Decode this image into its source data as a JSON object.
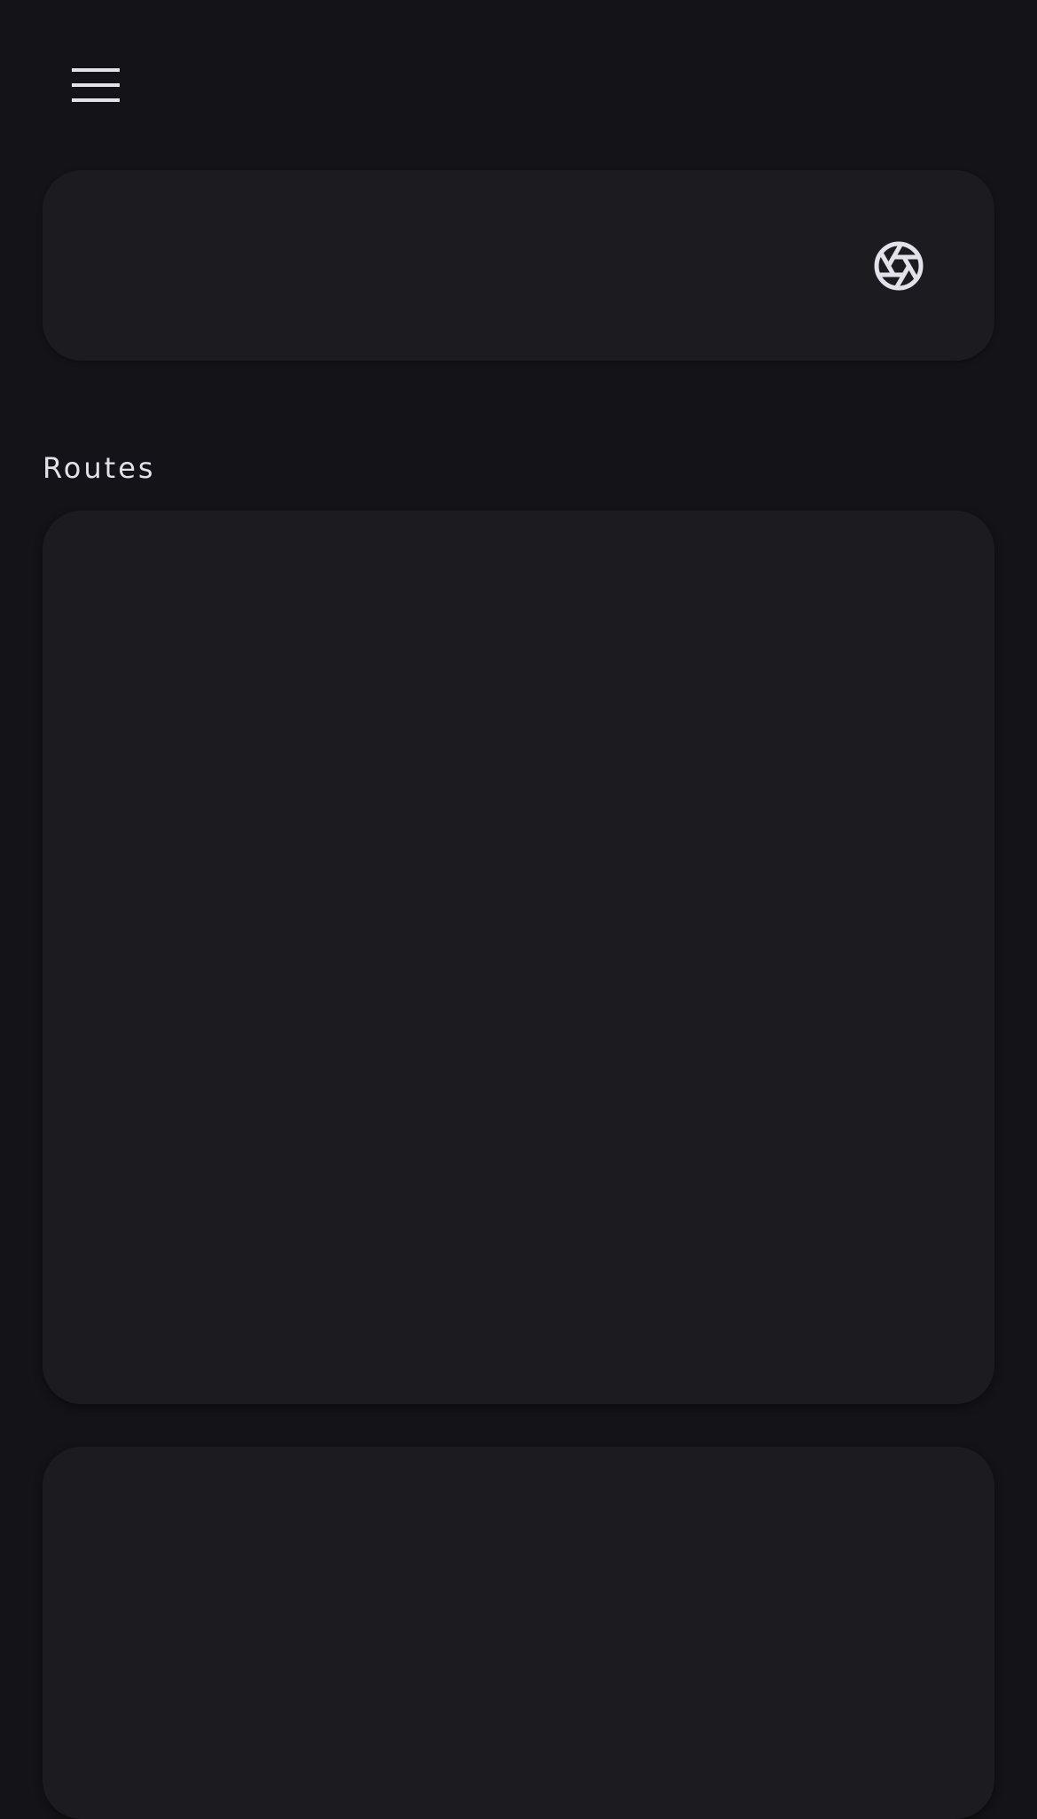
{
  "app_bar": {
    "menu_icon": "menu-icon"
  },
  "top_card": {
    "action_icon": "aperture-icon"
  },
  "routes_section": {
    "title": "Routes",
    "cards": [
      {},
      {}
    ]
  },
  "colors": {
    "background": "#141317",
    "card": "#1c1b20",
    "icon": "#e3e1e9",
    "text": "#e3e1e9"
  }
}
